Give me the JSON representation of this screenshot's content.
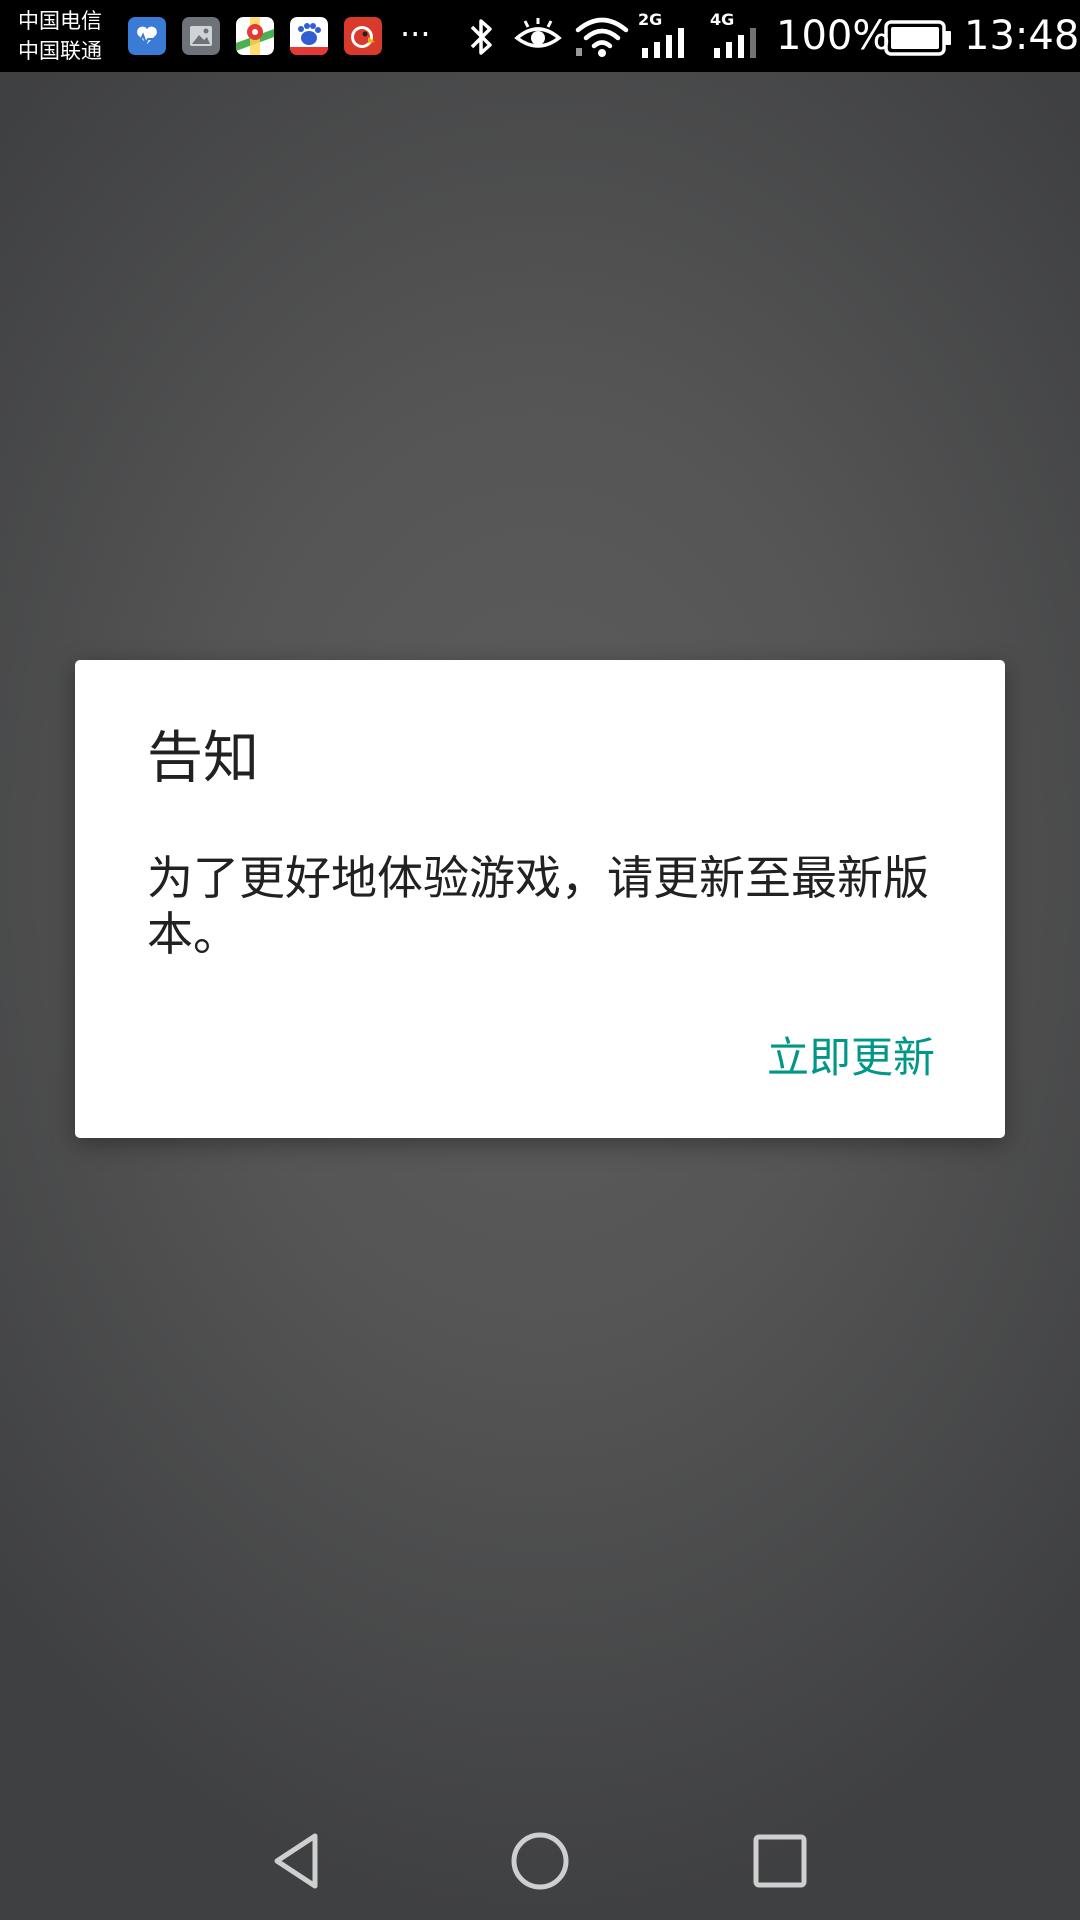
{
  "status_bar": {
    "carrier_1": "中国电信",
    "carrier_2": "中国联通",
    "more_notifications": "···",
    "net_2g": "2G",
    "net_4g": "4G",
    "battery_percent": "100%",
    "time": "13:48",
    "notification_icons": [
      "health-icon",
      "gallery-icon",
      "maps-icon",
      "baidu-icon",
      "parrot-app-icon"
    ]
  },
  "dialog": {
    "title": "告知",
    "message": "为了更好地体验游戏，请更新至最新版本。",
    "button_label": "立即更新",
    "accent_color": "#009688"
  },
  "nav_bar": {
    "icons": [
      "back-icon",
      "home-icon",
      "recents-icon"
    ]
  }
}
